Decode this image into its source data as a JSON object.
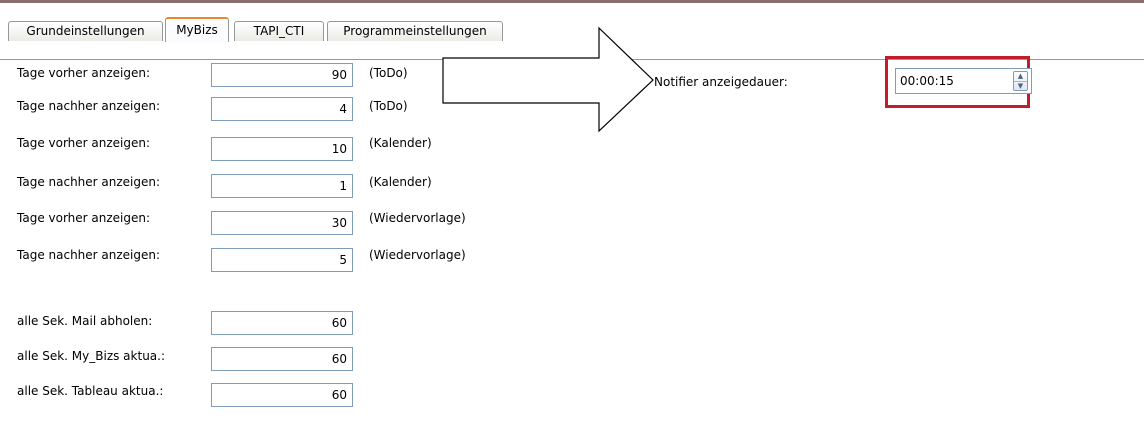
{
  "tabs": [
    {
      "label": "Grundeinstellungen",
      "active": false
    },
    {
      "label": "MyBizs",
      "active": true
    },
    {
      "label": "TAPI_CTI",
      "active": false
    },
    {
      "label": "Programmeinstellungen",
      "active": false
    }
  ],
  "rows": [
    {
      "label": "Tage vorher anzeigen:",
      "value": "90",
      "note": "(ToDo)"
    },
    {
      "label": "Tage nachher anzeigen:",
      "value": "4",
      "note": "(ToDo)"
    },
    {
      "label": "Tage vorher anzeigen:",
      "value": "10",
      "note": "(Kalender)"
    },
    {
      "label": "Tage nachher anzeigen:",
      "value": "1",
      "note": "(Kalender)"
    },
    {
      "label": "Tage vorher anzeigen:",
      "value": "30",
      "note": "(Wiedervorlage)"
    },
    {
      "label": "Tage nachher anzeigen:",
      "value": "5",
      "note": "(Wiedervorlage)"
    },
    {
      "label": "alle Sek. Mail abholen:",
      "value": "60",
      "note": ""
    },
    {
      "label": "alle Sek. My_Bizs aktua.:",
      "value": "60",
      "note": ""
    },
    {
      "label": "alle Sek. Tableau aktua.:",
      "value": "60",
      "note": ""
    }
  ],
  "notifier": {
    "label": "Notifier anzeigedauer:",
    "value": "00:00:15",
    "highlight_color": "#c21d2c"
  },
  "colors": {
    "active_tab_accent": "#e68b2c",
    "field_border": "#7f9db9"
  }
}
